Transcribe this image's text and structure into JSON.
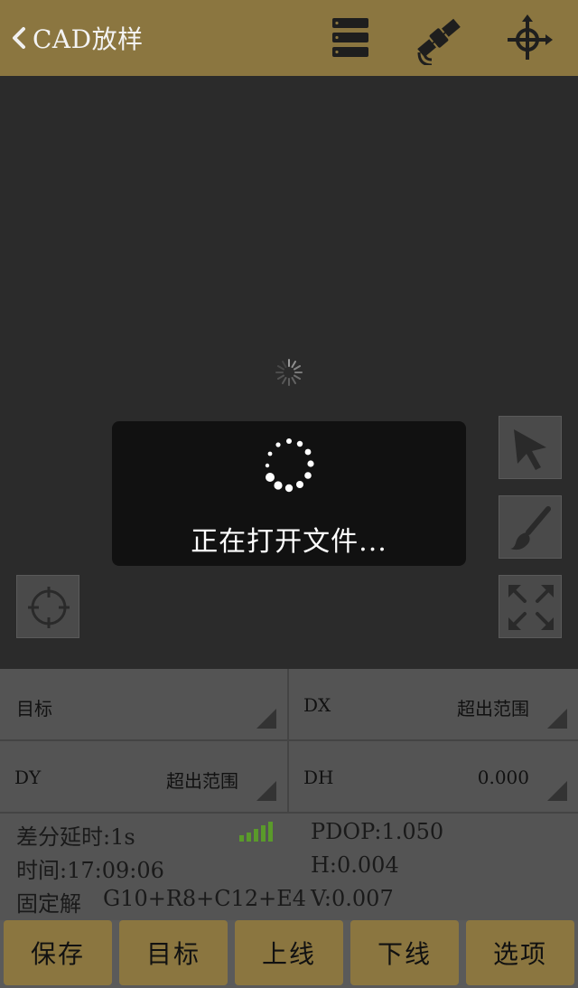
{
  "header": {
    "title": "CAD放样",
    "icons": [
      "menu-icon",
      "satellite-icon",
      "crosshair-icon"
    ]
  },
  "map": {
    "tools": [
      "cursor-icon",
      "brush-icon",
      "expand-icon",
      "locate-icon"
    ]
  },
  "loading": {
    "text": "正在打开文件..."
  },
  "fields": {
    "target": {
      "label": "目标",
      "value": ""
    },
    "dx": {
      "label": "DX",
      "value": "超出范围"
    },
    "dy": {
      "label": "DY",
      "value": "超出范围"
    },
    "dh": {
      "label": "DH",
      "value": "0.000"
    }
  },
  "status": {
    "diff_delay": "差分延时:1s",
    "pdop": "PDOP:1.050",
    "time": "时间:17:09:06",
    "h": "H:0.004",
    "solution": "固定解",
    "satellites": "G10+R8+C12+E4",
    "v": "V:0.007"
  },
  "buttons": {
    "save": "保存",
    "target": "目标",
    "line_up": "上线",
    "line_down": "下线",
    "options": "选项"
  },
  "colors": {
    "accent": "#8b7640",
    "signal_green": "#5a9a2a"
  }
}
